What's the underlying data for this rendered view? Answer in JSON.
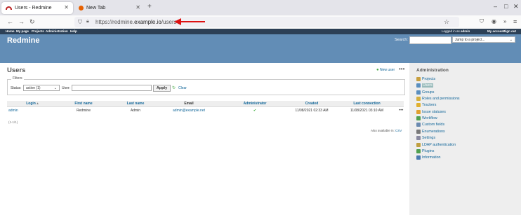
{
  "browser": {
    "tabs": [
      {
        "title": "Users - Redmine",
        "active": true
      },
      {
        "title": "New Tab",
        "active": false
      }
    ],
    "url_prefix": "https://redmine.",
    "url_host": "example.io",
    "url_path": "/users"
  },
  "topmenu": {
    "items": [
      "Home",
      "My page",
      "Projects",
      "Administration",
      "Help"
    ],
    "logged_in_prefix": "Logged in as",
    "logged_in_user": "admin",
    "my_account": "My account",
    "sign_out": "Sign out"
  },
  "header": {
    "title": "Redmine",
    "search_label": "Search:",
    "jump_placeholder": "Jump to a project..."
  },
  "page": {
    "title": "Users",
    "new_user": "New user",
    "filters": {
      "legend": "Filters",
      "status_label": "Status:",
      "status_value": "active (1)",
      "user_label": "User:",
      "apply": "Apply",
      "clear": "Clear"
    },
    "table": {
      "columns": [
        "Login",
        "First name",
        "Last name",
        "Email",
        "Administrator",
        "Created",
        "Last connection"
      ],
      "rows": [
        {
          "login": "admin",
          "first_name": "Redmine",
          "last_name": "Admin",
          "email": "admin@example.net",
          "administrator": "✔",
          "created": "11/08/2021 02:33 AM",
          "last_connection": "11/08/2021 03:10 AM"
        }
      ]
    },
    "pagination": "(1-1/1)",
    "also_available": "Also available in:",
    "csv": "CSV"
  },
  "sidebar": {
    "title": "Administration",
    "items": [
      {
        "label": "Projects",
        "icon": "projects-icon",
        "color": "#c8a040"
      },
      {
        "label": "Users",
        "icon": "users-icon",
        "color": "#5a8fc0",
        "selected": true
      },
      {
        "label": "Groups",
        "icon": "groups-icon",
        "color": "#5a8fc0"
      },
      {
        "label": "Roles and permissions",
        "icon": "roles-icon",
        "color": "#d4b040"
      },
      {
        "label": "Trackers",
        "icon": "trackers-icon",
        "color": "#e0b030"
      },
      {
        "label": "Issue statuses",
        "icon": "issue-statuses-icon",
        "color": "#e0a030"
      },
      {
        "label": "Workflow",
        "icon": "workflow-icon",
        "color": "#50a050"
      },
      {
        "label": "Custom fields",
        "icon": "custom-fields-icon",
        "color": "#6a8ab0"
      },
      {
        "label": "Enumerations",
        "icon": "enumerations-icon",
        "color": "#7a7a7a"
      },
      {
        "label": "Settings",
        "icon": "settings-icon",
        "color": "#8a8aa0"
      },
      {
        "label": "LDAP authentication",
        "icon": "ldap-icon",
        "color": "#c0a040"
      },
      {
        "label": "Plugins",
        "icon": "plugins-icon",
        "color": "#50a050"
      },
      {
        "label": "Information",
        "icon": "information-icon",
        "color": "#4a7ab0"
      }
    ]
  }
}
